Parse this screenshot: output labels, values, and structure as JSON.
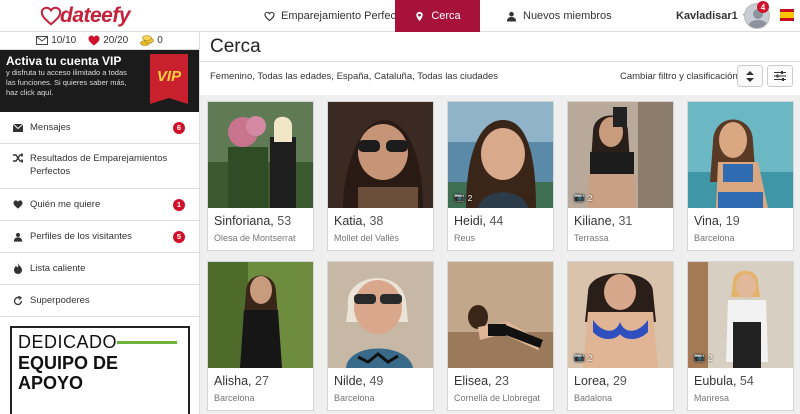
{
  "header": {
    "logo_text": "dateefy",
    "nav": [
      {
        "label": "Emparejamiento Perfecto",
        "icon": "heart-outline-icon"
      },
      {
        "label": "Cerca",
        "icon": "map-pin-icon",
        "active": true
      },
      {
        "label": "Nuevos miembros",
        "icon": "person-icon"
      }
    ],
    "username": "Kavladisar1",
    "notification_count": "4",
    "accent_color": "#a6123a"
  },
  "sidebar": {
    "counters": [
      {
        "icon": "envelope-icon",
        "value": "10/10"
      },
      {
        "icon": "heart-icon",
        "value": "20/20"
      },
      {
        "icon": "coins-icon",
        "value": "0"
      }
    ],
    "vip": {
      "title": "Activa tu cuenta VIP",
      "text": "y disfruta tu acceso ilimitado a todas las funciones. Si quieres saber más, haz click aquí.",
      "badge": "VIP"
    },
    "menu": [
      {
        "label": "Mensajes",
        "icon": "envelope-icon",
        "badge": "6"
      },
      {
        "label": "Resultados de Emparejamientos Perfectos",
        "icon": "shuffle-icon",
        "badge": ""
      },
      {
        "label": "Quién me quiere",
        "icon": "heart-icon",
        "badge": "1"
      },
      {
        "label": "Perfiles de los visitantes",
        "icon": "person-icon",
        "badge": "5"
      },
      {
        "label": "Lista caliente",
        "icon": "flame-icon",
        "badge": ""
      },
      {
        "label": "Superpoderes",
        "icon": "refresh-icon",
        "badge": ""
      }
    ],
    "ad": {
      "line1": "DEDICADO",
      "line2": "EQUIPO DE",
      "line3": "APOYO"
    }
  },
  "main": {
    "title": "Cerca",
    "filters": "Femenino, Todas las edades, España, Cataluña, Todas las ciudades",
    "filter_button_label": "Cambiar filtro y clasificación:",
    "profiles": [
      {
        "name": "Sinforiana",
        "age": "53",
        "city": "Olesa de Montserrat",
        "photos": ""
      },
      {
        "name": "Katia",
        "age": "38",
        "city": "Mollet del Vallès",
        "photos": ""
      },
      {
        "name": "Heidi",
        "age": "44",
        "city": "Reus",
        "photos": "2"
      },
      {
        "name": "Kiliane",
        "age": "31",
        "city": "Terrassa",
        "photos": "2"
      },
      {
        "name": "Vina",
        "age": "19",
        "city": "Barcelona",
        "photos": ""
      },
      {
        "name": "Alisha",
        "age": "27",
        "city": "Barcelona",
        "photos": ""
      },
      {
        "name": "Nilde",
        "age": "49",
        "city": "Barcelona",
        "photos": ""
      },
      {
        "name": "Elisea",
        "age": "23",
        "city": "Cornellà de Llobregat",
        "photos": ""
      },
      {
        "name": "Lorea",
        "age": "29",
        "city": "Badalona",
        "photos": "2"
      },
      {
        "name": "Eubula",
        "age": "54",
        "city": "Manresa",
        "photos": "2"
      }
    ]
  }
}
